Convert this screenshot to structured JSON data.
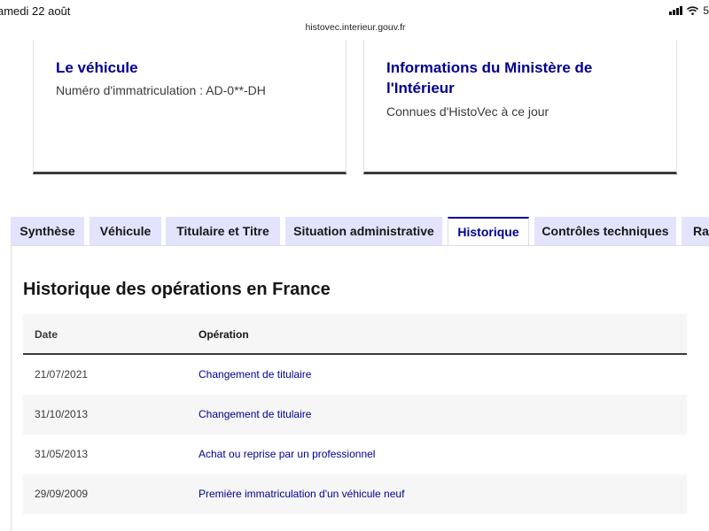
{
  "status_bar": {
    "time": "amedi 22 août",
    "battery": "5"
  },
  "browser": {
    "url": "histovec.interieur.gouv.fr"
  },
  "cards": [
    {
      "title": "Le véhicule",
      "text": "Numéro d'immatriculation : AD-0**-DH"
    },
    {
      "title": "Informations du Ministère de l'Intérieur",
      "text": "Connues d'HistoVec à ce jour"
    }
  ],
  "tabs": [
    {
      "label": "Synthèse"
    },
    {
      "label": "Véhicule"
    },
    {
      "label": "Titulaire et Titre"
    },
    {
      "label": "Situation administrative"
    },
    {
      "label": "Historique",
      "active": true
    },
    {
      "label": "Contrôles techniques"
    },
    {
      "label": "Rap"
    }
  ],
  "section": {
    "title": "Historique des opérations en France"
  },
  "table": {
    "headers": [
      "Date",
      "Opération"
    ],
    "rows": [
      {
        "date": "21/07/2021",
        "operation": "Changement de titulaire"
      },
      {
        "date": "31/10/2013",
        "operation": "Changement de titulaire"
      },
      {
        "date": "31/05/2013",
        "operation": "Achat ou reprise par un professionnel"
      },
      {
        "date": "29/09/2009",
        "operation": "Première immatriculation d'un véhicule neuf"
      }
    ]
  },
  "colors": {
    "primary": "#000091",
    "tab_bg": "#e3e3fd",
    "row_alt": "#f6f6f6"
  }
}
